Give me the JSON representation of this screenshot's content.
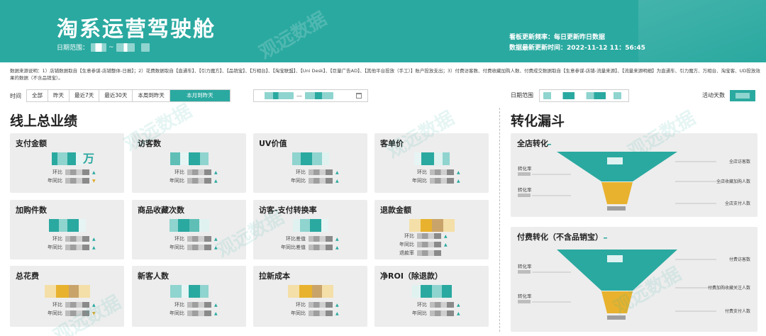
{
  "header": {
    "title": "淘系运营驾驶舱",
    "date_label": "日期范围：",
    "date_sep": "~",
    "update_freq": "看板更新频率：每日更新昨日数据",
    "last_update": "数据最新更新时间：2022-11-12  11：56:45"
  },
  "note": "数据来源说明：1）店铺数据取自【生意参谋-店铺整体-日报】；2）花费数据取自【直通车】、【引力魔方】、【品销宝】、【万相台】、【淘宝联盟】、【Uni Desk】、【巨量广告AD】、【其他平台投放（手工）】账户投放支出；3）付费访客数、付费收藏加购人数、付费成交数据取自【生意参谋-店铺-流量来源】、【流量来源明细】为直通车、引力魔方、万相台、淘宝客、UD投放效果的数据（不含品销宝）。",
  "time_filter": {
    "label": "时间",
    "options": [
      "全部",
      "昨天",
      "最近7天",
      "最近30天",
      "本周到昨天",
      "本月到昨天"
    ],
    "active": "本月到昨天",
    "date_sep": "—"
  },
  "right_filter": {
    "date_label": "日期范围",
    "days_label": "活动天数"
  },
  "left_section": {
    "title": "线上总业绩"
  },
  "right_section": {
    "title": "转化漏斗"
  },
  "cards": [
    {
      "title": "支付金额",
      "val_suffix": "万",
      "row1": "环比",
      "row2": "年同比",
      "row1_trend": "up",
      "row2_trend": "down"
    },
    {
      "title": "访客数",
      "row1": "环比",
      "row2": "年同比",
      "row1_trend": "up",
      "row2_trend": "up"
    },
    {
      "title": "UV价值",
      "row1": "环比",
      "row2": "年同比",
      "row1_trend": "up",
      "row2_trend": "up"
    },
    {
      "title": "客单价",
      "row1": "环比",
      "row2": "年同比",
      "row1_trend": "up",
      "row2_trend": "up"
    },
    {
      "title": "加购件数",
      "row1": "环比",
      "row2": "年同比",
      "row1_trend": "up",
      "row2_trend": "up"
    },
    {
      "title": "商品收藏次数",
      "row1": "环比",
      "row2": "年同比",
      "row1_trend": "up",
      "row2_trend": "up"
    },
    {
      "title": "访客-支付转换率",
      "row1": "环比差值",
      "row2": "年同比差值",
      "row1_trend": "up",
      "row2_trend": "up"
    },
    {
      "title": "退款金额",
      "row1": "环比",
      "row2": "年同比",
      "row3": "退款率",
      "row1_trend": "up",
      "row2_trend": "up"
    },
    {
      "title": "总花费",
      "row1": "环比",
      "row2": "年同比",
      "row1_trend": "up",
      "row2_trend": "down"
    },
    {
      "title": "新客人数",
      "row1": "环比",
      "row2": "年同比",
      "row1_trend": "up",
      "row2_trend": "up"
    },
    {
      "title": "拉新成本",
      "row1": "环比",
      "row2": "年同比",
      "row1_trend": "up",
      "row2_trend": "up"
    },
    {
      "title": "净ROI（除退款）",
      "row1": "环比",
      "row2": "年同比",
      "row1_trend": "up",
      "row2_trend": "up"
    }
  ],
  "funnels": [
    {
      "title": "全店转化",
      "rate1": "转化率",
      "rate2": "转化率",
      "stage1": "全店访客数",
      "stage2": "全店收藏加购人数",
      "stage3": "全店支付人数",
      "colors": {
        "top": "#2aa9a0",
        "mid": "#e8b22e"
      }
    },
    {
      "title": "付费转化（不含品销宝）",
      "rate1": "转化率",
      "rate2": "转化率",
      "stage1": "付费访客数",
      "stage2": "付费加购收藏关注人数",
      "stage3": "付费支付人数",
      "colors": {
        "top": "#2aa9a0",
        "mid": "#e8b22e"
      }
    }
  ],
  "watermark": "观远数据",
  "colors": {
    "accent": "#2aa9a0",
    "card_bg": "#ededed",
    "gold": "#e8b22e"
  }
}
